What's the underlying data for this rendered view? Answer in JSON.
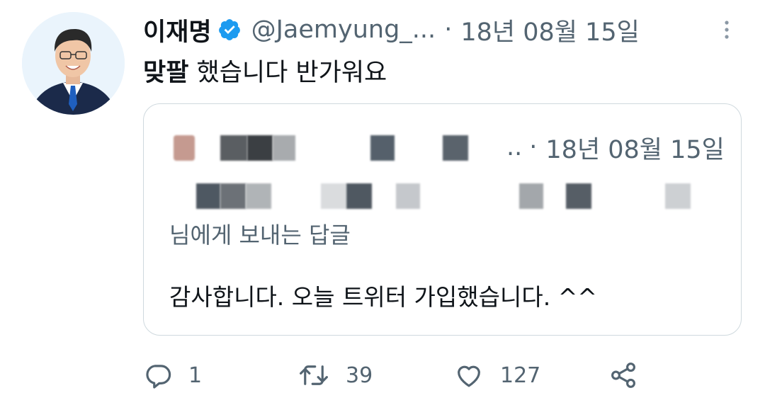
{
  "author": {
    "display_name": "이재명",
    "handle": "@Jaemyung_...",
    "timestamp": "18년 08월 15일",
    "separator": "·"
  },
  "tweet": {
    "text_bold": "맞팔",
    "text_rest": " 했습니다 반가워요"
  },
  "quote": {
    "ellipsis": "..",
    "separator": "·",
    "timestamp": "18년 08월 15일",
    "reply_to": "님에게 보내는 답글",
    "text": "감사합니다. 오늘 트위터 가입했습니다. ^^"
  },
  "actions": {
    "reply_count": "1",
    "retweet_count": "39",
    "like_count": "127"
  },
  "icons": {
    "verified": "verified-badge-icon",
    "more": "more-vertical-icon",
    "reply": "reply-icon",
    "retweet": "retweet-icon",
    "like": "heart-icon",
    "share": "share-icon"
  },
  "colors": {
    "verified_blue": "#1d9bf0",
    "secondary_text": "#536471",
    "border": "#cfd9de"
  }
}
